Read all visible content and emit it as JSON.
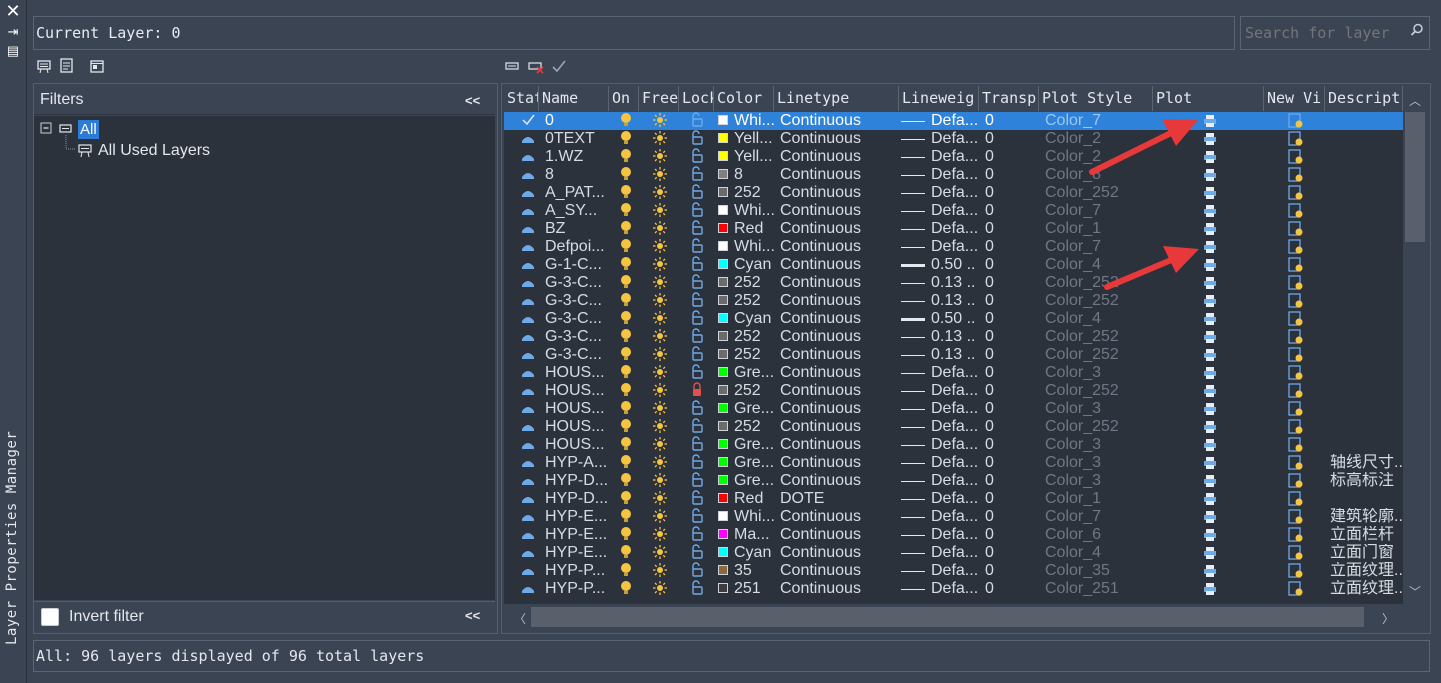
{
  "palette": {
    "title": "Layer Properties Manager"
  },
  "current_layer": {
    "label": "Current Layer: 0"
  },
  "search": {
    "placeholder": "Search for layer"
  },
  "filters": {
    "header": "Filters",
    "collapse": "<<",
    "tree": [
      {
        "label": "All",
        "selected": true
      },
      {
        "label": "All Used Layers",
        "selected": false
      }
    ],
    "invert_label": "Invert filter"
  },
  "grid": {
    "columns": [
      "Stat",
      "Name",
      "On",
      "Free",
      "Lock",
      "Color",
      "Linetype",
      "Lineweig",
      "Transp",
      "Plot Style",
      "Plot",
      "New Vi",
      "Descript"
    ],
    "rows": [
      {
        "name": "0",
        "color": "Whi...",
        "swatch": "#ffffff",
        "linetype": "Continuous",
        "lw": "Defa...",
        "thick": false,
        "transp": "0",
        "ps": "Color_7",
        "locked": false,
        "desc": "",
        "current": true
      },
      {
        "name": "0TEXT",
        "color": "Yell...",
        "swatch": "#ffff00",
        "linetype": "Continuous",
        "lw": "Defa...",
        "thick": false,
        "transp": "0",
        "ps": "Color_2",
        "locked": false,
        "desc": ""
      },
      {
        "name": "1.WZ",
        "color": "Yell...",
        "swatch": "#ffff00",
        "linetype": "Continuous",
        "lw": "Defa...",
        "thick": false,
        "transp": "0",
        "ps": "Color_2",
        "locked": false,
        "desc": ""
      },
      {
        "name": "8",
        "color": "8",
        "swatch": "#808080",
        "linetype": "Continuous",
        "lw": "Defa...",
        "thick": false,
        "transp": "0",
        "ps": "Color_8",
        "locked": false,
        "desc": ""
      },
      {
        "name": "A_PAT...",
        "color": "252",
        "swatch": "#6b6b6b",
        "linetype": "Continuous",
        "lw": "Defa...",
        "thick": false,
        "transp": "0",
        "ps": "Color_252",
        "locked": false,
        "desc": ""
      },
      {
        "name": "A_SY...",
        "color": "Whi...",
        "swatch": "#ffffff",
        "linetype": "Continuous",
        "lw": "Defa...",
        "thick": false,
        "transp": "0",
        "ps": "Color_7",
        "locked": false,
        "desc": ""
      },
      {
        "name": "BZ",
        "color": "Red",
        "swatch": "#ff0000",
        "linetype": "Continuous",
        "lw": "Defa...",
        "thick": false,
        "transp": "0",
        "ps": "Color_1",
        "locked": false,
        "desc": ""
      },
      {
        "name": "Defpoi...",
        "color": "Whi...",
        "swatch": "#ffffff",
        "linetype": "Continuous",
        "lw": "Defa...",
        "thick": false,
        "transp": "0",
        "ps": "Color_7",
        "locked": false,
        "desc": ""
      },
      {
        "name": "G-1-C...",
        "color": "Cyan",
        "swatch": "#00ffff",
        "linetype": "Continuous",
        "lw": "0.50 ...",
        "thick": true,
        "transp": "0",
        "ps": "Color_4",
        "locked": false,
        "desc": ""
      },
      {
        "name": "G-3-C...",
        "color": "252",
        "swatch": "#6b6b6b",
        "linetype": "Continuous",
        "lw": "0.13 ...",
        "thick": false,
        "transp": "0",
        "ps": "Color_252",
        "locked": false,
        "desc": ""
      },
      {
        "name": "G-3-C...",
        "color": "252",
        "swatch": "#6b6b6b",
        "linetype": "Continuous",
        "lw": "0.13 ...",
        "thick": false,
        "transp": "0",
        "ps": "Color_252",
        "locked": false,
        "desc": ""
      },
      {
        "name": "G-3-C...",
        "color": "Cyan",
        "swatch": "#00ffff",
        "linetype": "Continuous",
        "lw": "0.50 ...",
        "thick": true,
        "transp": "0",
        "ps": "Color_4",
        "locked": false,
        "desc": ""
      },
      {
        "name": "G-3-C...",
        "color": "252",
        "swatch": "#6b6b6b",
        "linetype": "Continuous",
        "lw": "0.13 ...",
        "thick": false,
        "transp": "0",
        "ps": "Color_252",
        "locked": false,
        "desc": ""
      },
      {
        "name": "G-3-C...",
        "color": "252",
        "swatch": "#6b6b6b",
        "linetype": "Continuous",
        "lw": "0.13 ...",
        "thick": false,
        "transp": "0",
        "ps": "Color_252",
        "locked": false,
        "desc": ""
      },
      {
        "name": "HOUS...",
        "color": "Gre...",
        "swatch": "#00ff00",
        "linetype": "Continuous",
        "lw": "Defa...",
        "thick": false,
        "transp": "0",
        "ps": "Color_3",
        "locked": false,
        "desc": ""
      },
      {
        "name": "HOUS...",
        "color": "252",
        "swatch": "#6b6b6b",
        "linetype": "Continuous",
        "lw": "Defa...",
        "thick": false,
        "transp": "0",
        "ps": "Color_252",
        "locked": true,
        "desc": ""
      },
      {
        "name": "HOUS...",
        "color": "Gre...",
        "swatch": "#00ff00",
        "linetype": "Continuous",
        "lw": "Defa...",
        "thick": false,
        "transp": "0",
        "ps": "Color_3",
        "locked": false,
        "desc": ""
      },
      {
        "name": "HOUS...",
        "color": "252",
        "swatch": "#6b6b6b",
        "linetype": "Continuous",
        "lw": "Defa...",
        "thick": false,
        "transp": "0",
        "ps": "Color_252",
        "locked": false,
        "desc": ""
      },
      {
        "name": "HOUS...",
        "color": "Gre...",
        "swatch": "#00ff00",
        "linetype": "Continuous",
        "lw": "Defa...",
        "thick": false,
        "transp": "0",
        "ps": "Color_3",
        "locked": false,
        "desc": ""
      },
      {
        "name": "HYP-A...",
        "color": "Gre...",
        "swatch": "#00ff00",
        "linetype": "Continuous",
        "lw": "Defa...",
        "thick": false,
        "transp": "0",
        "ps": "Color_3",
        "locked": false,
        "desc": "轴线尺寸..."
      },
      {
        "name": "HYP-D...",
        "color": "Gre...",
        "swatch": "#00ff00",
        "linetype": "Continuous",
        "lw": "Defa...",
        "thick": false,
        "transp": "0",
        "ps": "Color_3",
        "locked": false,
        "desc": "标高标注"
      },
      {
        "name": "HYP-D...",
        "color": "Red",
        "swatch": "#ff0000",
        "linetype": "DOTE",
        "lw": "Defa...",
        "thick": false,
        "transp": "0",
        "ps": "Color_1",
        "locked": false,
        "desc": ""
      },
      {
        "name": "HYP-E...",
        "color": "Whi...",
        "swatch": "#ffffff",
        "linetype": "Continuous",
        "lw": "Defa...",
        "thick": false,
        "transp": "0",
        "ps": "Color_7",
        "locked": false,
        "desc": "建筑轮廓..."
      },
      {
        "name": "HYP-E...",
        "color": "Ma...",
        "swatch": "#ff00ff",
        "linetype": "Continuous",
        "lw": "Defa...",
        "thick": false,
        "transp": "0",
        "ps": "Color_6",
        "locked": false,
        "desc": "立面栏杆"
      },
      {
        "name": "HYP-E...",
        "color": "Cyan",
        "swatch": "#00ffff",
        "linetype": "Continuous",
        "lw": "Defa...",
        "thick": false,
        "transp": "0",
        "ps": "Color_4",
        "locked": false,
        "desc": "立面门窗"
      },
      {
        "name": "HYP-P...",
        "color": "35",
        "swatch": "#8a6a3c",
        "linetype": "Continuous",
        "lw": "Defa...",
        "thick": false,
        "transp": "0",
        "ps": "Color_35",
        "locked": false,
        "desc": "立面纹理..."
      },
      {
        "name": "HYP-P...",
        "color": "251",
        "swatch": "#3c3c3c",
        "linetype": "Continuous",
        "lw": "Defa...",
        "thick": false,
        "transp": "0",
        "ps": "Color_251",
        "locked": false,
        "desc": "立面纹理..."
      }
    ]
  },
  "status": {
    "text": "All: 96 layers displayed of 96 total layers"
  },
  "colors": {
    "selection": "#2e82d9",
    "annotation_arrow": "#e8393a"
  }
}
